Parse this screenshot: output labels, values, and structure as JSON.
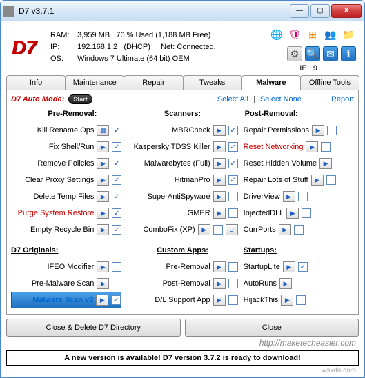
{
  "window": {
    "title": "D7  v3.7.1"
  },
  "titlebar": {
    "min": "—",
    "max": "▢",
    "close": "X"
  },
  "logo": "D7",
  "sysinfo": {
    "ram_label": "RAM:",
    "ram_total": "3,959 MB",
    "ram_used": "70 % Used  (1,188 MB Free)",
    "ip_label": "IP:",
    "ip": "192.168.1.2",
    "ip_type": "(DHCP)",
    "net_label": "Net:",
    "net": "Connected.",
    "os_label": "OS:",
    "os": "Windows 7 Ultimate  (64 bit) OEM",
    "ie_label": "IE:",
    "ie": "9"
  },
  "toolbar_icons": {
    "globe": "🌐",
    "shield": "🛡",
    "winflag": "⊞",
    "users": "👥",
    "folder": "📁",
    "gear": "⚙",
    "search": "🔍",
    "mail": "✉",
    "info": "ℹ"
  },
  "tabs": [
    "Info",
    "Maintenance",
    "Repair",
    "Tweaks",
    "Malware",
    "Offline Tools"
  ],
  "active_tab": "Malware",
  "automode": {
    "label": "D7 Auto Mode:",
    "start": "Start"
  },
  "links": {
    "select_all": "Select All",
    "select_none": "Select None",
    "report": "Report"
  },
  "sections": {
    "pre": "Pre-Removal:",
    "scan": "Scanners:",
    "post": "Post-Removal:",
    "orig": "D7 Originals:",
    "custom": "Custom Apps:",
    "startups": "Startups:"
  },
  "col1a": [
    {
      "label": "Kill Rename Ops",
      "icon": "▦",
      "checked": true
    },
    {
      "label": "Fix Shell/Run",
      "icon": "▶",
      "checked": true
    },
    {
      "label": "Remove Policies",
      "icon": "▶",
      "checked": true
    },
    {
      "label": "Clear Proxy Settings",
      "icon": "▶",
      "checked": true
    },
    {
      "label": "Delete Temp Files",
      "icon": "▶",
      "checked": true
    },
    {
      "label": "Purge System Restore",
      "icon": "▶",
      "checked": true,
      "red": true
    },
    {
      "label": "Empty Recycle Bin",
      "icon": "▶",
      "checked": true
    }
  ],
  "col1b": [
    {
      "label": "IFEO Modifier",
      "icon": "▶",
      "checked": false
    },
    {
      "label": "Pre-Malware Scan",
      "icon": "▶",
      "checked": false
    },
    {
      "label": "Malware Scan v2",
      "icon": "▶",
      "checked": true,
      "blue": true
    }
  ],
  "col2a": [
    {
      "label": "MBRCheck",
      "icon": "▶",
      "checked": true
    },
    {
      "label": "Kaspersky TDSS Killer",
      "icon": "▶",
      "checked": true
    },
    {
      "label": "Malwarebytes (Full)",
      "icon": "▶",
      "checked": true
    },
    {
      "label": "HitmanPro",
      "icon": "▶",
      "checked": true
    },
    {
      "label": "SuperAntiSpyware",
      "icon": "▶",
      "checked": false
    },
    {
      "label": "GMER",
      "icon": "▶",
      "checked": false
    },
    {
      "label": "ComboFix (XP)",
      "icon": "▶",
      "checked": false,
      "extra": "U"
    }
  ],
  "col2b": [
    {
      "label": "Pre-Removal",
      "icon": "▶",
      "checked": false
    },
    {
      "label": "Post-Removal",
      "icon": "▶",
      "checked": false
    },
    {
      "label": "D/L Support App",
      "icon": "▶",
      "checked": false
    }
  ],
  "col3a": [
    {
      "label": "Repair Permissions",
      "icon": "▶",
      "checked": false
    },
    {
      "label": "Reset Networking",
      "icon": "▶",
      "checked": false,
      "red": true
    },
    {
      "label": "Reset Hidden Volume",
      "icon": "▶",
      "checked": false
    },
    {
      "label": "Repair Lots of Stuff",
      "icon": "▶",
      "checked": false
    },
    {
      "label": "DriverView",
      "icon": "▶",
      "checked": false
    },
    {
      "label": "InjectedDLL",
      "icon": "▶",
      "checked": false
    },
    {
      "label": "CurrPorts",
      "icon": "▶",
      "checked": false
    }
  ],
  "col3b": [
    {
      "label": "StartupLite",
      "icon": "▶",
      "checked": true
    },
    {
      "label": "AutoRuns",
      "icon": "▶",
      "checked": false
    },
    {
      "label": "HijackThis",
      "icon": "▶",
      "checked": false
    }
  ],
  "buttons": {
    "close_delete": "Close & Delete D7 Directory",
    "close": "Close"
  },
  "banner": "A new version is available!  D7 version 3.7.2 is ready to download!",
  "watermark": "http://maketecheasier.com",
  "watermark2": "wsxdn.com"
}
